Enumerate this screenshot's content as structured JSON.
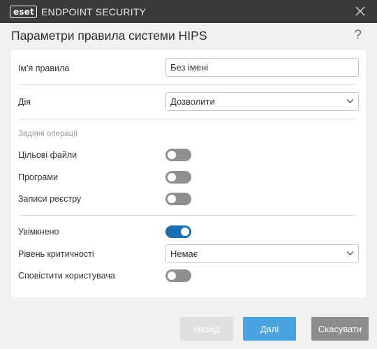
{
  "window": {
    "brand_logo_text": "eset",
    "app_name": "ENDPOINT SECURITY"
  },
  "dialog": {
    "title": "Параметри правила системи HIPS",
    "help_symbol": "?"
  },
  "form": {
    "rule_name_label": "Ім'я правила",
    "rule_name_value": "Без імені",
    "action_label": "Дія",
    "action_value": "Дозволити",
    "operations_section": "Задіяні операції",
    "target_files_label": "Цільові файли",
    "target_files_on": false,
    "apps_label": "Програми",
    "apps_on": false,
    "registry_label": "Записи реєстру",
    "registry_on": false,
    "enabled_label": "Увімкнено",
    "enabled_on": true,
    "severity_label": "Рівень критичності",
    "severity_value": "Немає",
    "notify_label": "Сповістити користувача",
    "notify_on": false
  },
  "buttons": {
    "back": "Назад",
    "next": "Далі",
    "cancel": "Скасувати"
  },
  "colors": {
    "titlebar": "#383a3c",
    "toggle_on": "#1d6fb0",
    "toggle_off": "#8f8f8f",
    "primary_button": "#4aa3dc",
    "cancel_button": "#8c8c8c",
    "disabled_button": "#e0e0e0"
  }
}
